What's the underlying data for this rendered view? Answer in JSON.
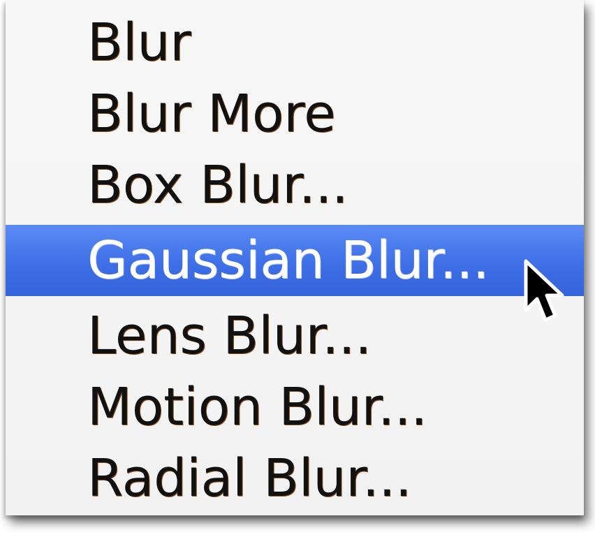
{
  "menu": {
    "items": [
      {
        "label": "Blur"
      },
      {
        "label": "Blur More"
      },
      {
        "label": "Box Blur..."
      },
      {
        "label": "Gaussian Blur...",
        "selected": true
      },
      {
        "label": "Lens Blur..."
      },
      {
        "label": "Motion Blur..."
      },
      {
        "label": "Radial Blur..."
      }
    ],
    "highlight_color": "#3e6fe6"
  },
  "cursor": {
    "icon": "arrow-pointer-icon"
  }
}
